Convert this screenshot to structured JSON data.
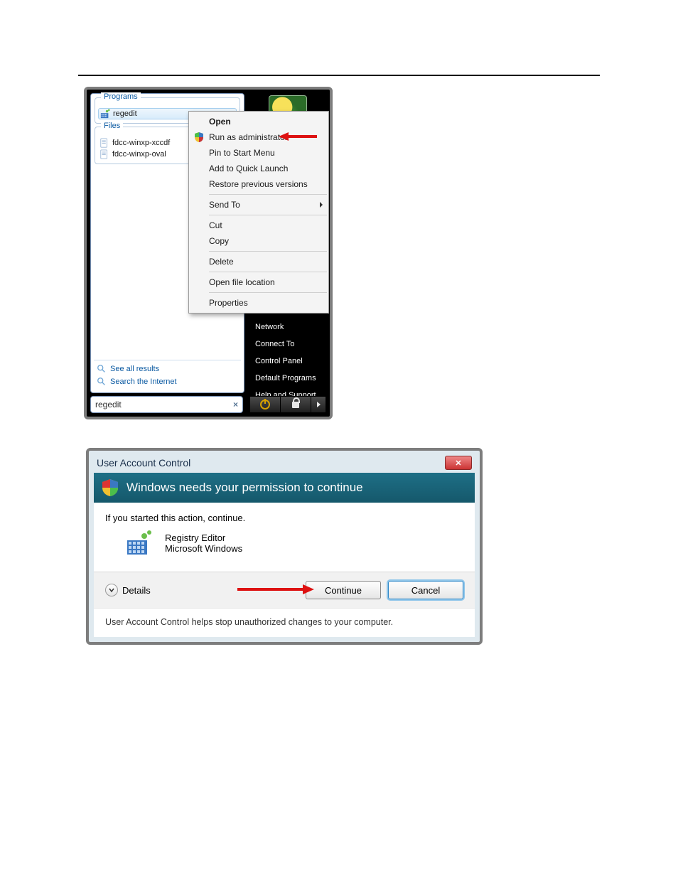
{
  "start_menu": {
    "programs_legend": "Programs",
    "program_result": "regedit",
    "files_legend": "Files",
    "file_results": [
      "fdcc-winxp-xccdf",
      "fdcc-winxp-oval"
    ],
    "see_all": "See all results",
    "search_internet": "Search the Internet",
    "search_value": "regedit",
    "right_items": [
      "Network",
      "Connect To",
      "Control Panel",
      "Default Programs",
      "Help and Support"
    ]
  },
  "context_menu": {
    "open": "Open",
    "run_as_admin": "Run as administrator",
    "pin": "Pin to Start Menu",
    "quick_launch": "Add to Quick Launch",
    "restore": "Restore previous versions",
    "send_to": "Send To",
    "cut": "Cut",
    "copy": "Copy",
    "delete": "Delete",
    "open_loc": "Open file location",
    "properties": "Properties"
  },
  "uac": {
    "title": "User Account Control",
    "banner": "Windows needs your permission to continue",
    "prompt": "If you started this action, continue.",
    "program_name": "Registry Editor",
    "publisher": "Microsoft Windows",
    "details": "Details",
    "continue": "Continue",
    "cancel": "Cancel",
    "foot": "User Account Control helps stop unauthorized changes to your computer."
  }
}
